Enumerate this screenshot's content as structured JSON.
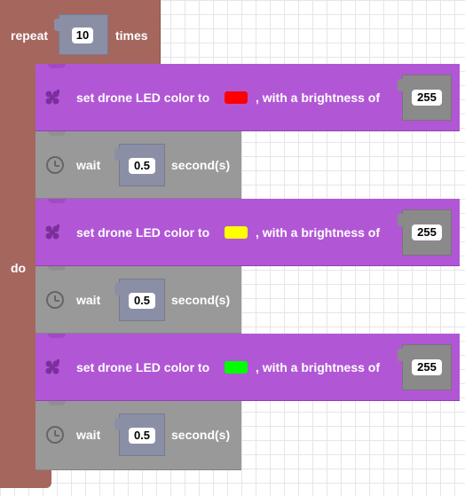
{
  "repeat": {
    "label": "repeat",
    "count": "10",
    "times_label": "times",
    "do_label": "do"
  },
  "blocks": [
    {
      "type": "led",
      "label": "set drone LED color to",
      "color": "#ff0000",
      "suffix": ", with a brightness of",
      "brightness": "255"
    },
    {
      "type": "wait",
      "label": "wait",
      "value": "0.5",
      "unit": "second(s)"
    },
    {
      "type": "led",
      "label": "set drone LED color to",
      "color": "#ffff00",
      "suffix": ", with a brightness of",
      "brightness": "255"
    },
    {
      "type": "wait",
      "label": "wait",
      "value": "0.5",
      "unit": "second(s)"
    },
    {
      "type": "led",
      "label": "set drone LED color to",
      "color": "#00ff00",
      "suffix": ", with a brightness of",
      "brightness": "255"
    },
    {
      "type": "wait",
      "label": "wait",
      "value": "0.5",
      "unit": "second(s)"
    }
  ],
  "colors": {
    "repeat": "#a5665e",
    "led_block": "#b157d6",
    "wait_block": "#999999"
  },
  "icons": {
    "led": "drone-icon",
    "wait": "clock-icon"
  }
}
